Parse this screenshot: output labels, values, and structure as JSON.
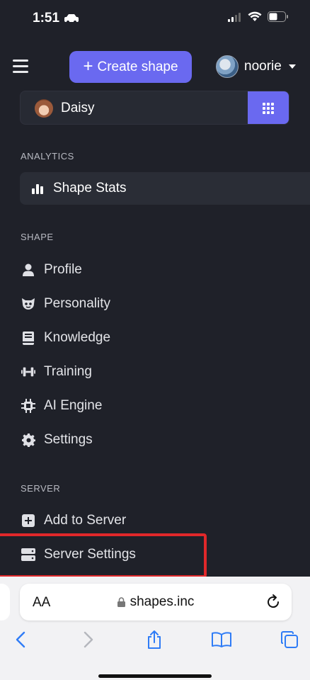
{
  "status_bar": {
    "time": "1:51"
  },
  "header": {
    "create_label": "Create shape",
    "user_name": "noorie"
  },
  "shape_selector": {
    "name": "Daisy"
  },
  "sections": {
    "analytics": "ANALYTICS",
    "shape": "SHAPE",
    "server": "SERVER"
  },
  "analytics_items": [
    {
      "label": "Shape Stats",
      "icon": "bar-chart-icon"
    }
  ],
  "shape_items": [
    {
      "label": "Profile",
      "icon": "person-icon"
    },
    {
      "label": "Personality",
      "icon": "mask-icon"
    },
    {
      "label": "Knowledge",
      "icon": "book-icon"
    },
    {
      "label": "Training",
      "icon": "dumbbell-icon"
    },
    {
      "label": "AI Engine",
      "icon": "chip-icon"
    },
    {
      "label": "Settings",
      "icon": "gear-icon"
    }
  ],
  "server_items": [
    {
      "label": "Add to Server",
      "icon": "plus-square-icon"
    },
    {
      "label": "Server Settings",
      "icon": "server-icon"
    }
  ],
  "browser": {
    "aa_label": "AA",
    "url": "shapes.inc"
  },
  "colors": {
    "accent": "#6a69f0",
    "background": "#1f2129",
    "highlight": "#e0282a",
    "safari_blue": "#2f7cf6"
  }
}
